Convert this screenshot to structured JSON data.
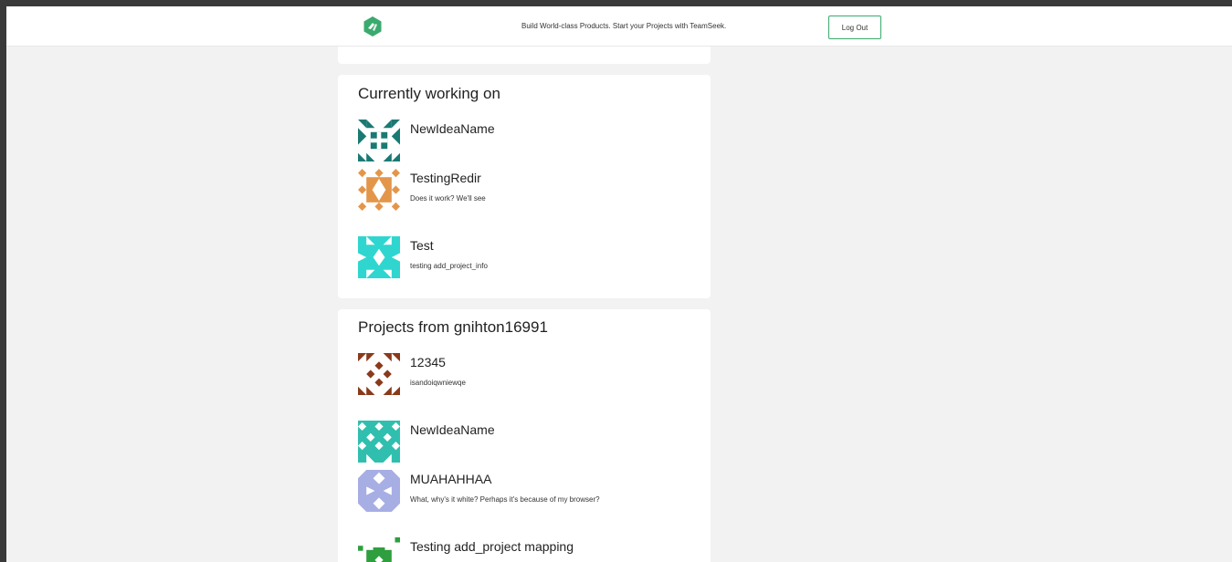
{
  "header": {
    "tagline": "Build World-class Products. Start your Projects with TeamSeek.",
    "logout_label": "Log Out",
    "logo_color": "#3aaa6e"
  },
  "working": {
    "title": "Currently working on",
    "items": [
      {
        "name": "NewIdeaName",
        "desc": "",
        "color": "#1a7a73"
      },
      {
        "name": "TestingRedir",
        "desc": "Does it work? We'll see",
        "color": "#e3964a"
      },
      {
        "name": "Test",
        "desc": "testing add_project_info",
        "color": "#2fd6cf"
      }
    ]
  },
  "projects": {
    "title": "Projects from gnihton16991",
    "items": [
      {
        "name": "12345",
        "desc": "isandoiqwniewqe",
        "color": "#8a3a1a"
      },
      {
        "name": "NewIdeaName",
        "desc": "",
        "color": "#30bfae"
      },
      {
        "name": "MUAHAHHAA",
        "desc": "What, why's it white? Perhaps it's because of my browser?",
        "color": "#a7aee4"
      },
      {
        "name": "Testing add_project mapping",
        "desc": "",
        "color": "#2e9e3e"
      }
    ]
  }
}
